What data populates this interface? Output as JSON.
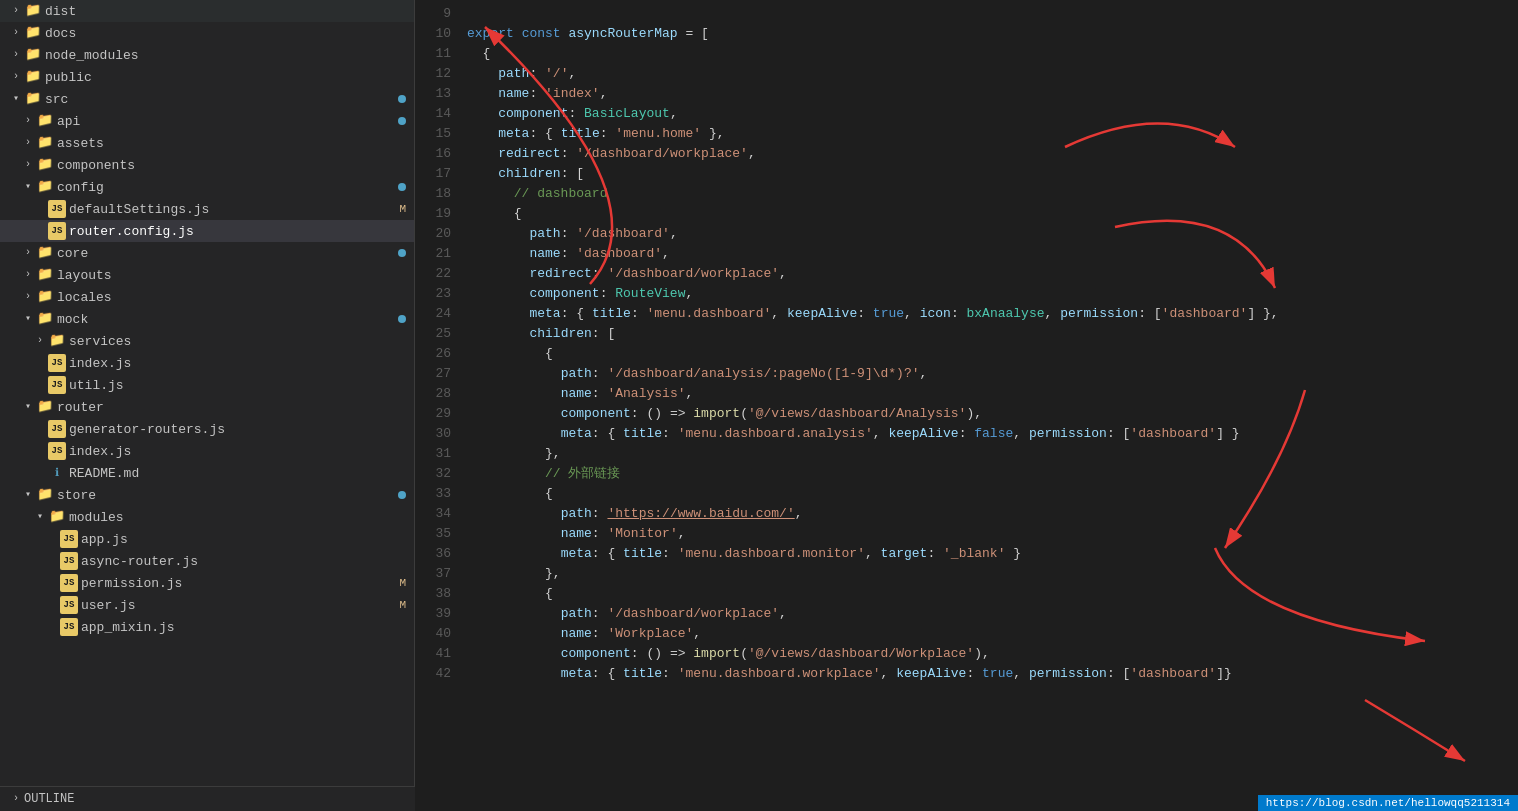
{
  "sidebar": {
    "items": [
      {
        "id": "dist",
        "label": "dist",
        "type": "folder",
        "indent": "indent-0",
        "state": "closed",
        "badge": ""
      },
      {
        "id": "docs",
        "label": "docs",
        "type": "folder",
        "indent": "indent-0",
        "state": "closed",
        "badge": ""
      },
      {
        "id": "node_modules",
        "label": "node_modules",
        "type": "folder",
        "indent": "indent-0",
        "state": "closed",
        "badge": ""
      },
      {
        "id": "public",
        "label": "public",
        "type": "folder",
        "indent": "indent-0",
        "state": "closed",
        "badge": ""
      },
      {
        "id": "src",
        "label": "src",
        "type": "folder",
        "indent": "indent-0",
        "state": "open",
        "badge": "dot"
      },
      {
        "id": "api",
        "label": "api",
        "type": "folder",
        "indent": "indent-1",
        "state": "closed",
        "badge": "dot"
      },
      {
        "id": "assets",
        "label": "assets",
        "type": "folder",
        "indent": "indent-1",
        "state": "closed",
        "badge": ""
      },
      {
        "id": "components",
        "label": "components",
        "type": "folder",
        "indent": "indent-1",
        "state": "closed",
        "badge": ""
      },
      {
        "id": "config",
        "label": "config",
        "type": "folder",
        "indent": "indent-1",
        "state": "open",
        "badge": "dot"
      },
      {
        "id": "defaultSettings.js",
        "label": "defaultSettings.js",
        "type": "js",
        "indent": "indent-2",
        "state": "none",
        "badge": "M"
      },
      {
        "id": "router.config.js",
        "label": "router.config.js",
        "type": "js",
        "indent": "indent-2",
        "state": "none",
        "badge": "",
        "active": true
      },
      {
        "id": "core",
        "label": "core",
        "type": "folder",
        "indent": "indent-1",
        "state": "closed",
        "badge": "dot"
      },
      {
        "id": "layouts",
        "label": "layouts",
        "type": "folder",
        "indent": "indent-1",
        "state": "closed",
        "badge": ""
      },
      {
        "id": "locales",
        "label": "locales",
        "type": "folder",
        "indent": "indent-1",
        "state": "closed",
        "badge": ""
      },
      {
        "id": "mock",
        "label": "mock",
        "type": "folder",
        "indent": "indent-1",
        "state": "open",
        "badge": "dot"
      },
      {
        "id": "services",
        "label": "services",
        "type": "folder",
        "indent": "indent-2",
        "state": "closed",
        "badge": ""
      },
      {
        "id": "index.js-mock",
        "label": "index.js",
        "type": "js",
        "indent": "indent-2",
        "state": "none",
        "badge": ""
      },
      {
        "id": "util.js",
        "label": "util.js",
        "type": "js",
        "indent": "indent-2",
        "state": "none",
        "badge": ""
      },
      {
        "id": "router",
        "label": "router",
        "type": "folder",
        "indent": "indent-1",
        "state": "open",
        "badge": ""
      },
      {
        "id": "generator-routers.js",
        "label": "generator-routers.js",
        "type": "js",
        "indent": "indent-2",
        "state": "none",
        "badge": ""
      },
      {
        "id": "index.js-router",
        "label": "index.js",
        "type": "js",
        "indent": "indent-2",
        "state": "none",
        "badge": ""
      },
      {
        "id": "README.md",
        "label": "README.md",
        "type": "info",
        "indent": "indent-2",
        "state": "none",
        "badge": ""
      },
      {
        "id": "store",
        "label": "store",
        "type": "folder",
        "indent": "indent-1",
        "state": "open",
        "badge": "dot"
      },
      {
        "id": "modules",
        "label": "modules",
        "type": "folder",
        "indent": "indent-2",
        "state": "open",
        "badge": ""
      },
      {
        "id": "app.js",
        "label": "app.js",
        "type": "js",
        "indent": "indent-3",
        "state": "none",
        "badge": ""
      },
      {
        "id": "async-router.js",
        "label": "async-router.js",
        "type": "js",
        "indent": "indent-3",
        "state": "none",
        "badge": ""
      },
      {
        "id": "permission.js",
        "label": "permission.js",
        "type": "js",
        "indent": "indent-3",
        "state": "none",
        "badge": "M"
      },
      {
        "id": "user.js",
        "label": "user.js",
        "type": "js",
        "indent": "indent-3",
        "state": "none",
        "badge": "M"
      },
      {
        "id": "app_mixin.js",
        "label": "app_mixin.js",
        "type": "js",
        "indent": "indent-3",
        "state": "none",
        "badge": ""
      }
    ],
    "outline_label": "OUTLINE"
  },
  "editor": {
    "lines": [
      {
        "num": 9,
        "content": ""
      },
      {
        "num": 10,
        "content": "export const asyncRouterMap = ["
      },
      {
        "num": 11,
        "content": "  {"
      },
      {
        "num": 12,
        "content": "    path: '/',"
      },
      {
        "num": 13,
        "content": "    name: 'index',"
      },
      {
        "num": 14,
        "content": "    component: BasicLayout,"
      },
      {
        "num": 15,
        "content": "    meta: { title: 'menu.home' },"
      },
      {
        "num": 16,
        "content": "    redirect: '/dashboard/workplace',"
      },
      {
        "num": 17,
        "content": "    children: ["
      },
      {
        "num": 18,
        "content": "      // dashboard"
      },
      {
        "num": 19,
        "content": "      {"
      },
      {
        "num": 20,
        "content": "        path: '/dashboard',"
      },
      {
        "num": 21,
        "content": "        name: 'dashboard',"
      },
      {
        "num": 22,
        "content": "        redirect: '/dashboard/workplace',"
      },
      {
        "num": 23,
        "content": "        component: RouteView,"
      },
      {
        "num": 24,
        "content": "        meta: { title: 'menu.dashboard', keepAlive: true, icon: bxAnaalyse, permission: ['dashboard'] },"
      },
      {
        "num": 25,
        "content": "        children: ["
      },
      {
        "num": 26,
        "content": "          {"
      },
      {
        "num": 27,
        "content": "            path: '/dashboard/analysis/:pageNo([1-9]\\\\d*)?',"
      },
      {
        "num": 28,
        "content": "            name: 'Analysis',"
      },
      {
        "num": 29,
        "content": "            component: () => import('@/views/dashboard/Analysis'),"
      },
      {
        "num": 30,
        "content": "            meta: { title: 'menu.dashboard.analysis', keepAlive: false, permission: ['dashboard'] }"
      },
      {
        "num": 31,
        "content": "          },"
      },
      {
        "num": 32,
        "content": "          // 外部链接"
      },
      {
        "num": 33,
        "content": "          {"
      },
      {
        "num": 34,
        "content": "            path: 'https://www.baidu.com/',"
      },
      {
        "num": 35,
        "content": "            name: 'Monitor',"
      },
      {
        "num": 36,
        "content": "            meta: { title: 'menu.dashboard.monitor', target: '_blank' }"
      },
      {
        "num": 37,
        "content": "          },"
      },
      {
        "num": 38,
        "content": "          {"
      },
      {
        "num": 39,
        "content": "            path: '/dashboard/workplace',"
      },
      {
        "num": 40,
        "content": "            name: 'Workplace',"
      },
      {
        "num": 41,
        "content": "            component: () => import('@/views/dashboard/Workplace'),"
      },
      {
        "num": 42,
        "content": "            meta: { title: 'menu.dashboard.workplace', keepAlive: true, permission: ['dashboard']"
      }
    ]
  },
  "status_bar": {
    "text": "https://blog.csdn.net/hellowqq5211314"
  }
}
